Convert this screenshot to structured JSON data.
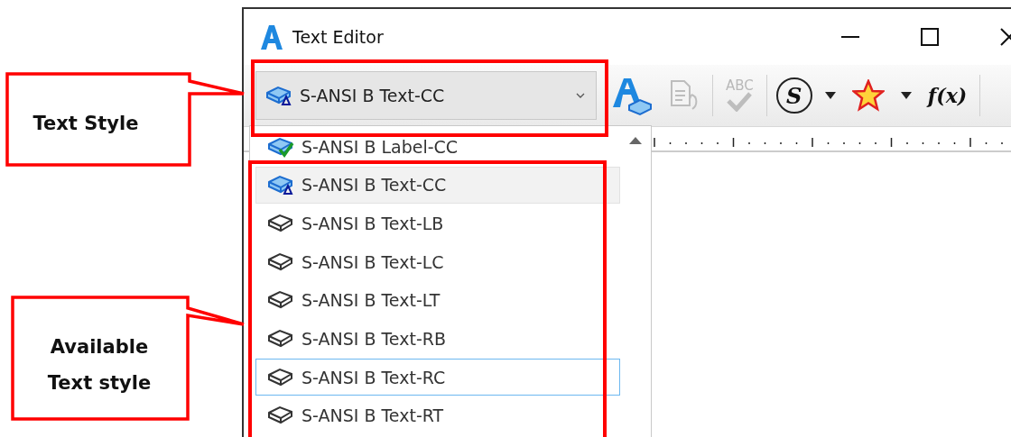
{
  "window": {
    "title": "Text Editor"
  },
  "toolbar": {
    "style_combo": {
      "value": "S-ANSI B Text-CC"
    },
    "tools": [
      {
        "kind": "style",
        "disabled": false
      },
      {
        "kind": "import",
        "disabled": true
      },
      {
        "kind": "spell",
        "glyph": "ABC",
        "disabled": true
      },
      {
        "kind": "symbol",
        "glyph": "S",
        "disabled": false
      },
      {
        "kind": "menu",
        "disabled": false
      },
      {
        "kind": "favorite",
        "disabled": false
      },
      {
        "kind": "menu",
        "disabled": false
      },
      {
        "kind": "field",
        "glyph": "f(x)",
        "disabled": false
      }
    ]
  },
  "style_list": [
    {
      "label": "S-ANSI B Label-CC",
      "kind": "label",
      "highlighted": false,
      "focused": false
    },
    {
      "label": "S-ANSI B Text-CC",
      "kind": "active",
      "highlighted": true,
      "focused": false
    },
    {
      "label": "S-ANSI B Text-LB",
      "kind": "plain",
      "highlighted": false,
      "focused": false
    },
    {
      "label": "S-ANSI B Text-LC",
      "kind": "plain",
      "highlighted": false,
      "focused": false
    },
    {
      "label": "S-ANSI B Text-LT",
      "kind": "plain",
      "highlighted": false,
      "focused": false
    },
    {
      "label": "S-ANSI B Text-RB",
      "kind": "plain",
      "highlighted": false,
      "focused": false
    },
    {
      "label": "S-ANSI B Text-RC",
      "kind": "plain",
      "highlighted": false,
      "focused": true
    },
    {
      "label": "S-ANSI B Text-RT",
      "kind": "plain",
      "highlighted": false,
      "focused": false
    }
  ],
  "callouts": [
    {
      "text": "Text Style"
    },
    {
      "text": "Available Text style"
    }
  ]
}
